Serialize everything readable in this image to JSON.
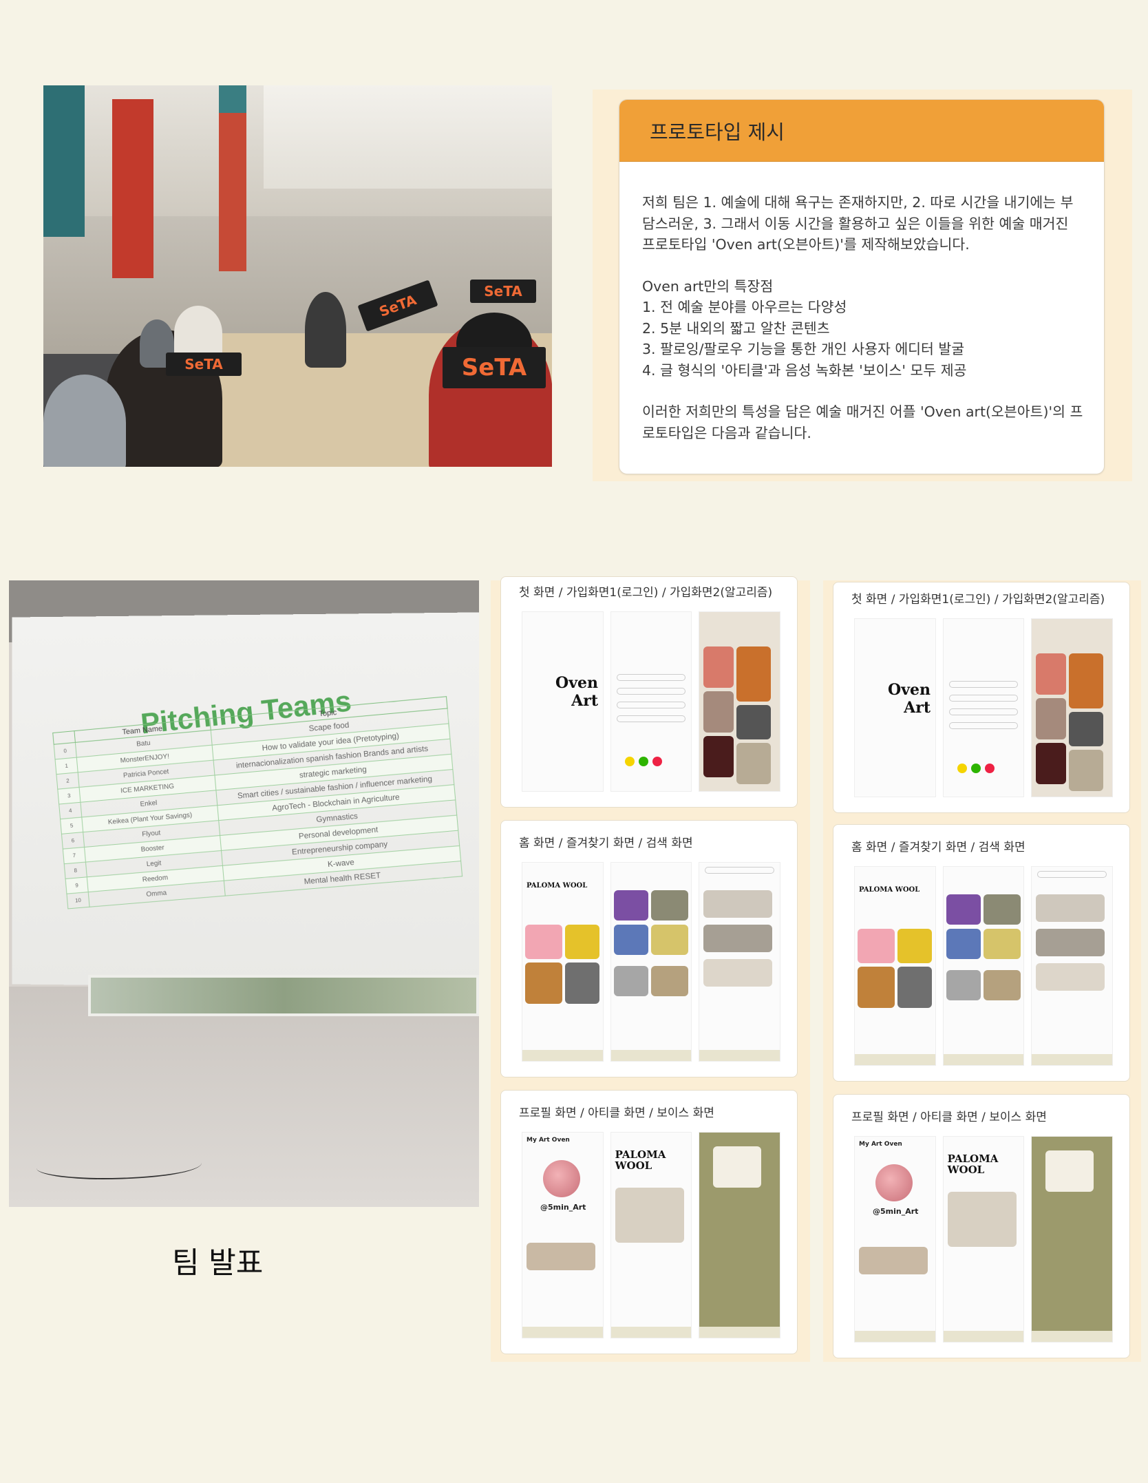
{
  "proto_card": {
    "heading": "프로토타입 제시",
    "para1": "저희 팀은 1. 예술에 대해 욕구는 존재하지만,  2. 따로 시간을 내기에는 부담스러운, 3. 그래서 이동 시간을 활용하고 싶은 이들을 위한 예술 매거진 프로토타입 'Oven art(오븐아트)'를 제작해보았습니다.",
    "features_title": "Oven art만의 특장점",
    "features": [
      "1. 전 예술 분야를 아우르는 다양성",
      "2. 5분 내외의 짧고 알찬 콘텐츠",
      "3. 팔로잉/팔로우 기능을 통한 개인 사용자 에디터 발굴",
      "4. 글 형식의 '아티클'과 음성 녹화본 '보이스' 모두 제공"
    ],
    "para3": "이러한 저희만의 특성을 담은 예술 매거진 어플 'Oven art(오븐아트)'의 프로토타입은 다음과 같습니다."
  },
  "classroom_photo": {
    "signs": [
      "SeTA",
      "SeTA",
      "SeTA",
      "SeTA"
    ]
  },
  "pitch_photo": {
    "slide_title": "Pitching Teams",
    "col_team": "Team Name",
    "col_topic": "Topic",
    "rows": [
      {
        "num": "0",
        "team": "Batu",
        "topic": "Scape food"
      },
      {
        "num": "1",
        "team": "MonsterENJOY!",
        "topic": "How to validate your idea (Pretotyping)"
      },
      {
        "num": "2",
        "team": "Patricia Poncet",
        "topic": "internacionalization spanish fashion Brands and artists"
      },
      {
        "num": "3",
        "team": "ICE MARKETING",
        "topic": "strategic marketing"
      },
      {
        "num": "4",
        "team": "Enkel",
        "topic": "Smart cities / sustainable fashion / influencer marketing"
      },
      {
        "num": "5",
        "team": "Keikea (Plant Your Savings)",
        "topic": "AgroTech - Blockchain in Agriculture"
      },
      {
        "num": "6",
        "team": "Flyout",
        "topic": "Gymnastics"
      },
      {
        "num": "7",
        "team": "Booster",
        "topic": "Personal development"
      },
      {
        "num": "8",
        "team": "Legit",
        "topic": "Entrepreneurship company"
      },
      {
        "num": "9",
        "team": "Reedom",
        "topic": "K-wave"
      },
      {
        "num": "10",
        "team": "Omma",
        "topic": "Mental health RESET"
      }
    ]
  },
  "caption": "팀 발표",
  "mockups": {
    "card1_title": "첫 화면 / 가입화면1(로그인) / 가입화면2(알고리즘)",
    "card2_title": "홈 화면 / 즐겨찾기 화면 / 검색 화면",
    "card3_title": "프로필 화면 / 아티클 화면 / 보이스 화면",
    "logo_line1": "Oven",
    "logo_line2": "Art",
    "home_brand": "PALOMA WOOL",
    "profile_app": "My Art Oven",
    "profile_handle": "@5min_Art",
    "article_brand": "PALOMA WOOL"
  },
  "colors": {
    "background": "#f6f3e6",
    "proto_header": "#f0a038",
    "mock_panel": "#fbeed5",
    "sign_text": "#f06a35",
    "slide_green": "#55a85a"
  }
}
